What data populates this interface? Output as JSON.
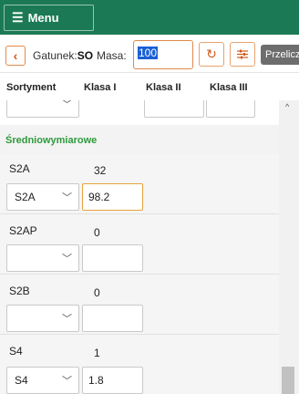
{
  "topbar": {
    "menu_label": "Menu",
    "menu_icon": "hamburger-icon",
    "color": "#1b7a55"
  },
  "toolbar": {
    "gatunek_label": "Gatunek:",
    "gatunek_value": "SO",
    "masa_label": "Masa:",
    "masa_value": "100",
    "przelicz_label": "Przelicz",
    "accent": "#e08a4a"
  },
  "table": {
    "headers": [
      "Sortyment",
      "Klasa I",
      "Klasa II",
      "Klasa III"
    ]
  },
  "section": {
    "title": "Średniowymiarowe",
    "color": "#2e9a3c"
  },
  "rows": [
    {
      "name": "S2A",
      "value": "32",
      "select_value": "S2A",
      "input_value": "98.2"
    },
    {
      "name": "S2AP",
      "value": "0",
      "select_value": "",
      "input_value": ""
    },
    {
      "name": "S2B",
      "value": "0",
      "select_value": "",
      "input_value": ""
    },
    {
      "name": "S4",
      "value": "1",
      "select_value": "S4",
      "input_value": "1.8"
    }
  ]
}
